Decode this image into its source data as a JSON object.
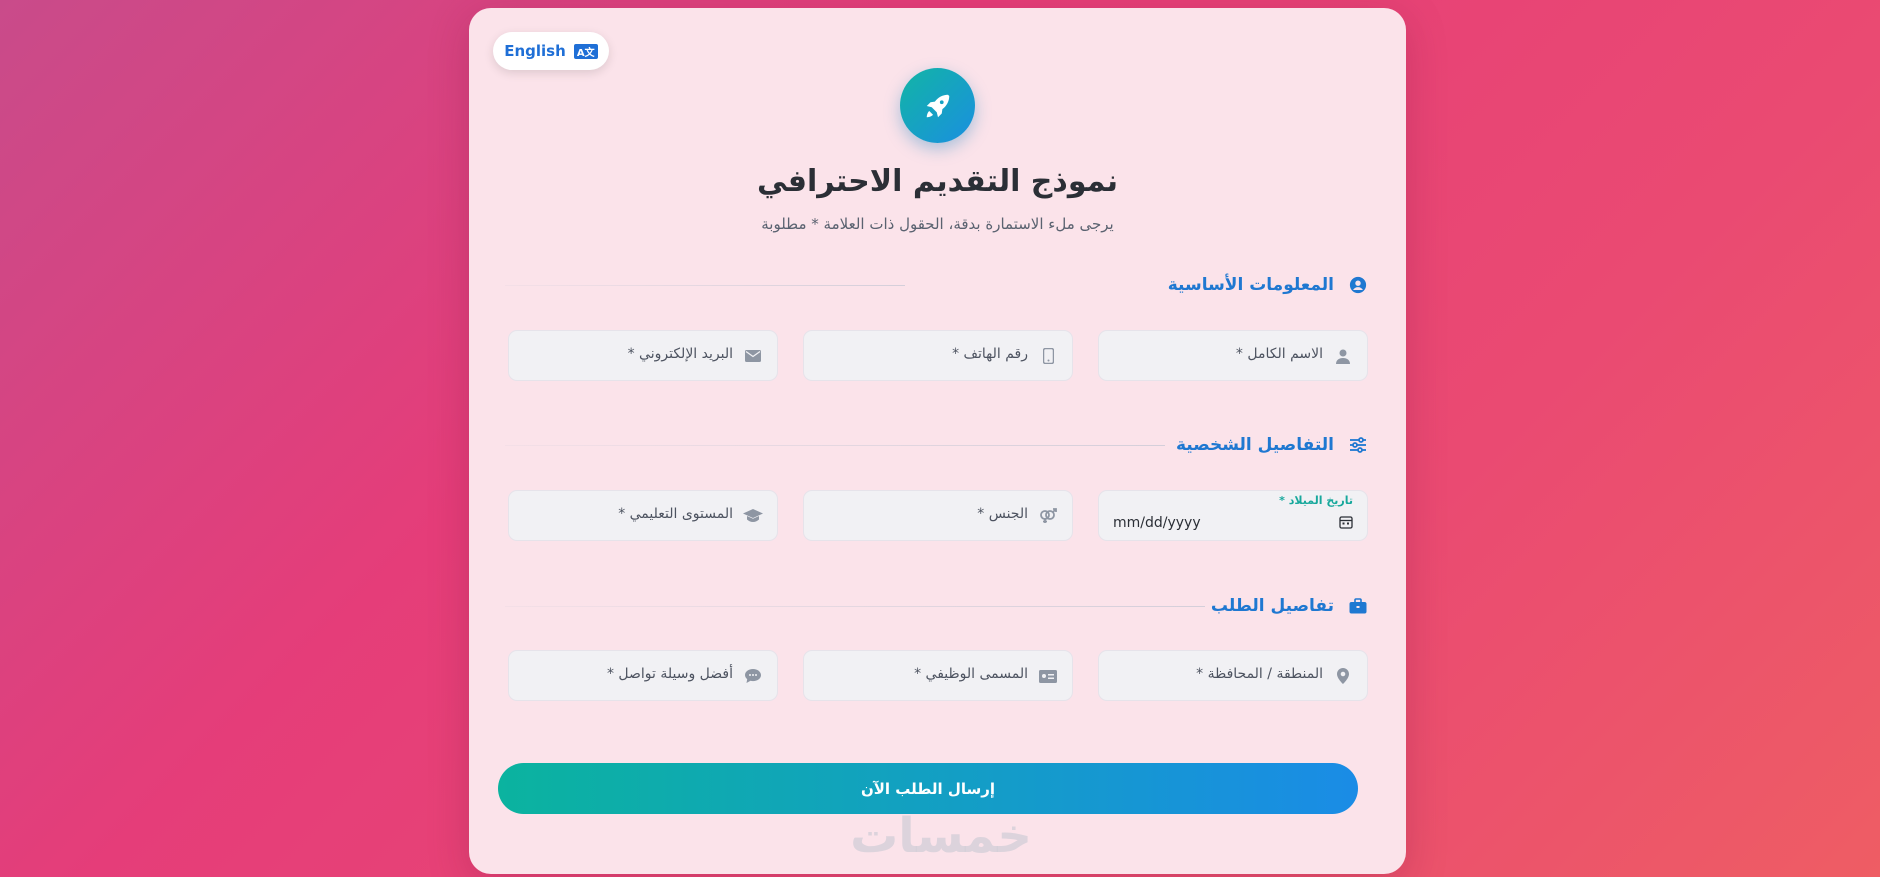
{
  "language_toggle": {
    "label": "English",
    "icon": "translate-icon"
  },
  "header": {
    "title": "نموذج التقديم الاحترافي",
    "subtitle": "يرجى ملء الاستمارة بدقة، الحقول ذات العلامة * مطلوبة",
    "logo_icon": "rocket-icon"
  },
  "sections": [
    {
      "title": "المعلومات الأساسية",
      "icon": "user-circle-icon",
      "fields": [
        {
          "placeholder": "الاسم الكامل *",
          "icon": "user-icon"
        },
        {
          "placeholder": "رقم الهاتف *",
          "icon": "mobile-icon"
        },
        {
          "placeholder": "البريد الإلكتروني *",
          "icon": "envelope-icon"
        }
      ]
    },
    {
      "title": "التفاصيل الشخصية",
      "icon": "sliders-icon",
      "fields": [
        {
          "label": "تاريخ الميلاد *",
          "value": "mm/dd/yyyy",
          "icon": "calendar-icon"
        },
        {
          "placeholder": "الجنس *",
          "icon": "gender-icon"
        },
        {
          "placeholder": "المستوى التعليمي *",
          "icon": "graduation-cap-icon"
        }
      ]
    },
    {
      "title": "تفاصيل الطلب",
      "icon": "briefcase-icon",
      "fields": [
        {
          "placeholder": "المنطقة / المحافظة *",
          "icon": "map-marker-icon"
        },
        {
          "placeholder": "المسمى الوظيفي *",
          "icon": "id-card-icon"
        },
        {
          "placeholder": "أفضل وسيلة تواصل *",
          "icon": "chat-icon"
        }
      ]
    }
  ],
  "submit": {
    "label": "إرسال الطلب الآن"
  },
  "watermark": {
    "text": "خمسات"
  },
  "colors": {
    "accent": "#1f78d1",
    "teal": "#0bb39f",
    "card": "#fbe3ea"
  }
}
